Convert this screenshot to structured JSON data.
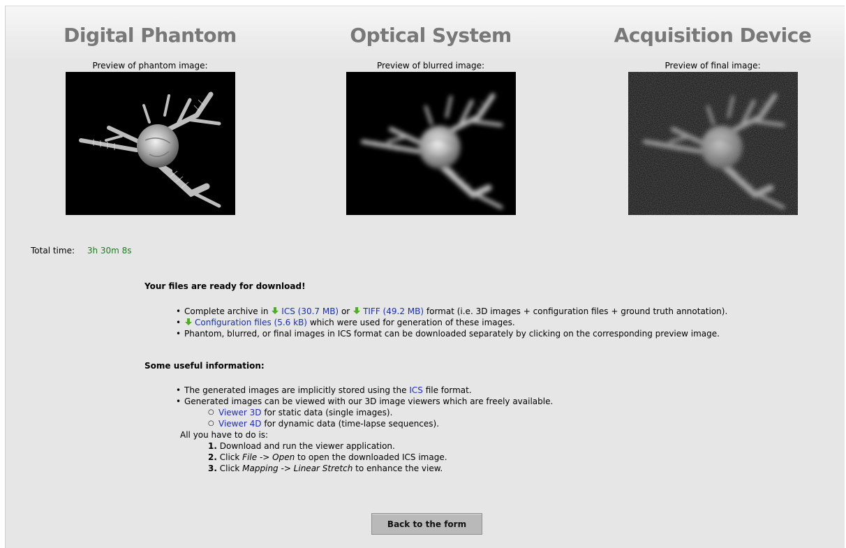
{
  "columns": [
    {
      "title": "Digital Phantom",
      "caption": "Preview of phantom image:"
    },
    {
      "title": "Optical System",
      "caption": "Preview of blurred image:"
    },
    {
      "title": "Acquisition Device",
      "caption": "Preview of final image:"
    }
  ],
  "total": {
    "label": "Total time:",
    "value": "3h 30m 8s"
  },
  "downloads": {
    "heading": "Your files are ready for download!",
    "item1": {
      "prefix": "Complete archive in",
      "ics_link": "ICS (30.7 MB)",
      "or": "or",
      "tiff_link": "TIFF (49.2 MB)",
      "suffix": "format (i.e. 3D images + configuration files + ground truth annotation)."
    },
    "item2": {
      "link": "Configuration files (5.6 kB)",
      "suffix": "which were used for generation of these images."
    },
    "item3": "Phantom, blurred, or final images in ICS format can be downloaded separately by clicking on the corresponding preview image."
  },
  "info": {
    "heading": "Some useful information:",
    "item1": {
      "prefix": "The generated images are implicitly stored using the",
      "link": "ICS",
      "suffix": "file format."
    },
    "item2": "Generated images can be viewed with our 3D image viewers which are freely available.",
    "sub1": {
      "link": "Viewer 3D",
      "suffix": "for static data (single images)."
    },
    "sub2": {
      "link": "Viewer 4D",
      "suffix": "for dynamic data (time-lapse sequences)."
    },
    "todo": "All you have to do is:",
    "step1": {
      "num": "1.",
      "text": "Download and run the viewer application."
    },
    "step2": {
      "num": "2.",
      "pre": "Click",
      "em": "File -> Open",
      "post": "to open the downloaded ICS image."
    },
    "step3": {
      "num": "3.",
      "pre": "Click",
      "em": "Mapping -> Linear Stretch",
      "post": "to enhance the view."
    }
  },
  "back_button": "Back to the form",
  "colors": {
    "link": "#1a2fb5",
    "time": "#1f7a1f",
    "title": "#787878",
    "arrow": "#4caf1e"
  }
}
